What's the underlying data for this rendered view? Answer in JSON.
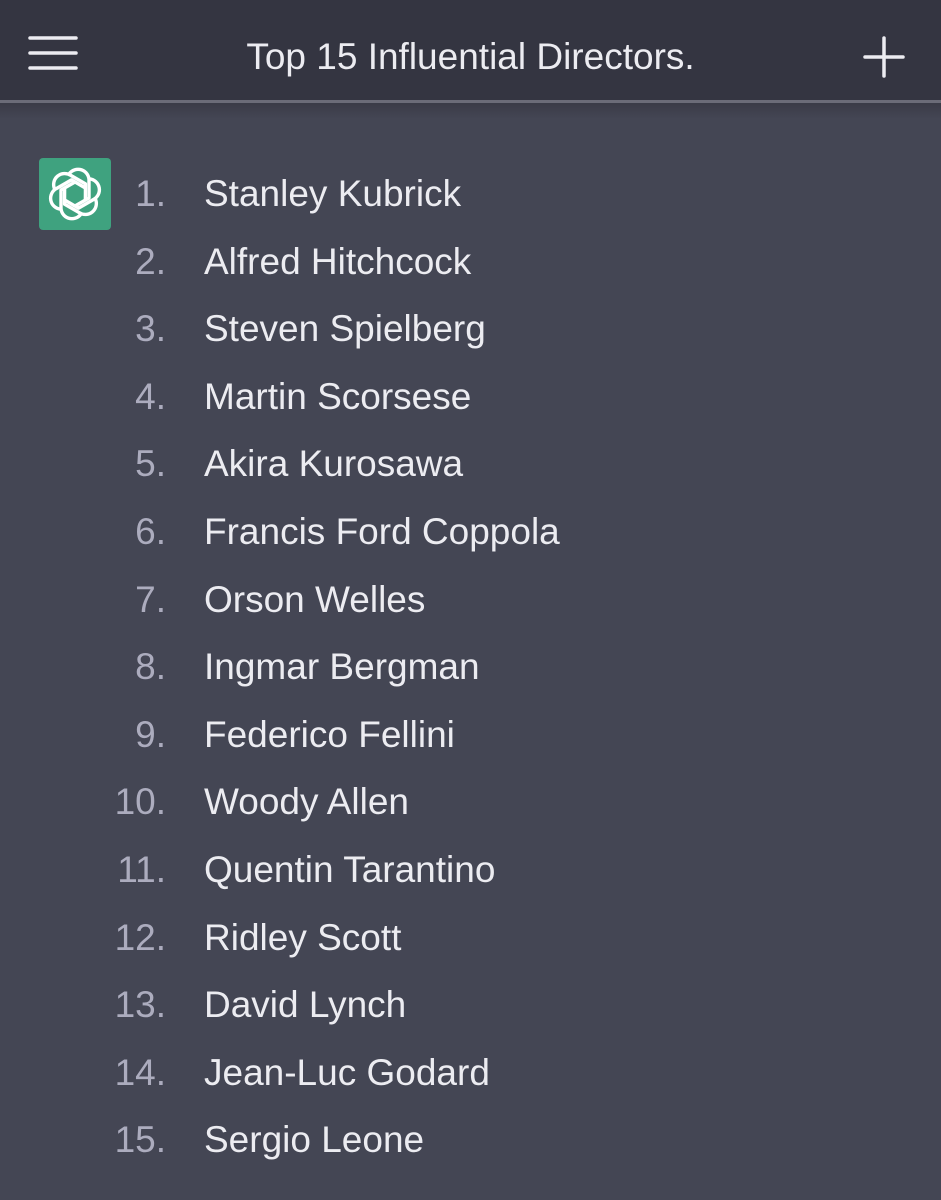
{
  "header": {
    "title": "Top 15 Influential Directors.",
    "menu_icon": "hamburger-menu-icon",
    "new_chat_icon": "plus-icon"
  },
  "message": {
    "avatar_icon": "openai-logo-icon",
    "avatar_color": "#3fa27f",
    "items": [
      {
        "number": "1.",
        "name": "Stanley Kubrick"
      },
      {
        "number": "2.",
        "name": "Alfred Hitchcock"
      },
      {
        "number": "3.",
        "name": "Steven Spielberg"
      },
      {
        "number": "4.",
        "name": "Martin Scorsese"
      },
      {
        "number": "5.",
        "name": "Akira Kurosawa"
      },
      {
        "number": "6.",
        "name": "Francis Ford Coppola"
      },
      {
        "number": "7.",
        "name": "Orson Welles"
      },
      {
        "number": "8.",
        "name": "Ingmar Bergman"
      },
      {
        "number": "9.",
        "name": "Federico Fellini"
      },
      {
        "number": "10.",
        "name": "Woody Allen"
      },
      {
        "number": "11.",
        "name": "Quentin Tarantino"
      },
      {
        "number": "12.",
        "name": "Ridley Scott"
      },
      {
        "number": "13.",
        "name": "David Lynch"
      },
      {
        "number": "14.",
        "name": "Jean-Luc Godard"
      },
      {
        "number": "15.",
        "name": "Sergio Leone"
      }
    ]
  },
  "colors": {
    "header_bg": "#343541",
    "content_bg": "#444654",
    "text": "#ececf1",
    "number_text": "#acacbe"
  }
}
